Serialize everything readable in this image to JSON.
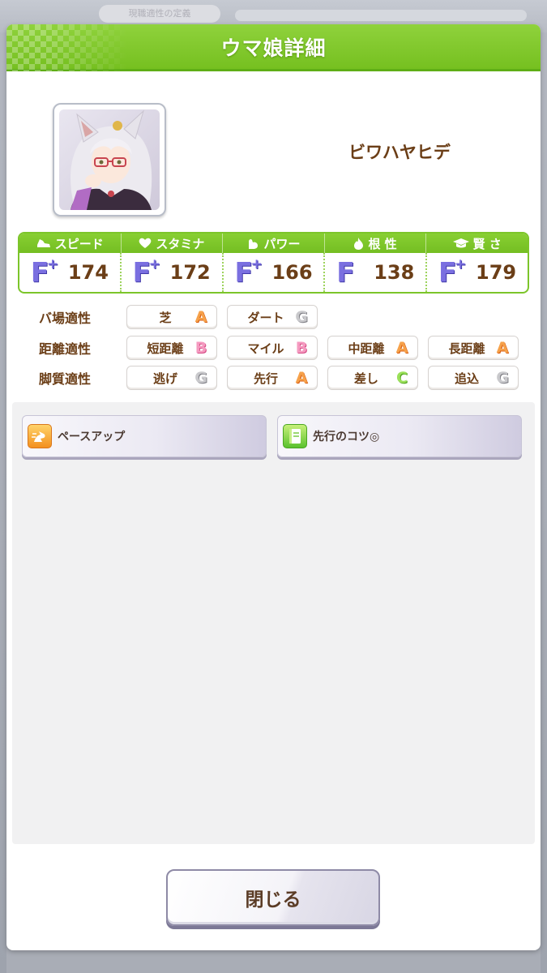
{
  "background": {
    "tab_label": "現職適性の定義"
  },
  "dialog": {
    "title": "ウマ娘詳細",
    "header_color": "#7cc52a"
  },
  "character": {
    "name": "ビワハヤヒデ"
  },
  "stats": [
    {
      "label": "スピード",
      "icon": "shoe-icon",
      "rank": "F",
      "plus": "+",
      "value": "174"
    },
    {
      "label": "スタミナ",
      "icon": "heart-icon",
      "rank": "F",
      "plus": "+",
      "value": "172"
    },
    {
      "label": "パワー",
      "icon": "muscle-icon",
      "rank": "F",
      "plus": "+",
      "value": "166"
    },
    {
      "label": "根 性",
      "icon": "flame-icon",
      "rank": "F",
      "plus": "",
      "value": "138"
    },
    {
      "label": "賢 さ",
      "icon": "graduation-cap-icon",
      "rank": "F",
      "plus": "+",
      "value": "179"
    }
  ],
  "aptitude": {
    "track": {
      "label": "バ場適性",
      "items": [
        {
          "name": "芝",
          "grade": "A"
        },
        {
          "name": "ダート",
          "grade": "G"
        }
      ]
    },
    "distance": {
      "label": "距離適性",
      "items": [
        {
          "name": "短距離",
          "grade": "B"
        },
        {
          "name": "マイル",
          "grade": "B"
        },
        {
          "name": "中距離",
          "grade": "A"
        },
        {
          "name": "長距離",
          "grade": "A"
        }
      ]
    },
    "style": {
      "label": "脚質適性",
      "items": [
        {
          "name": "逃げ",
          "grade": "G"
        },
        {
          "name": "先行",
          "grade": "A"
        },
        {
          "name": "差し",
          "grade": "C"
        },
        {
          "name": "追込",
          "grade": "G"
        }
      ]
    }
  },
  "skills": [
    {
      "name": "ペースアップ",
      "icon": "speed-skill-icon",
      "color": "#f3901f"
    },
    {
      "name": "先行のコツ◎",
      "icon": "book-skill-icon",
      "color": "#5bc22e"
    }
  ],
  "buttons": {
    "close_label": "閉じる"
  }
}
